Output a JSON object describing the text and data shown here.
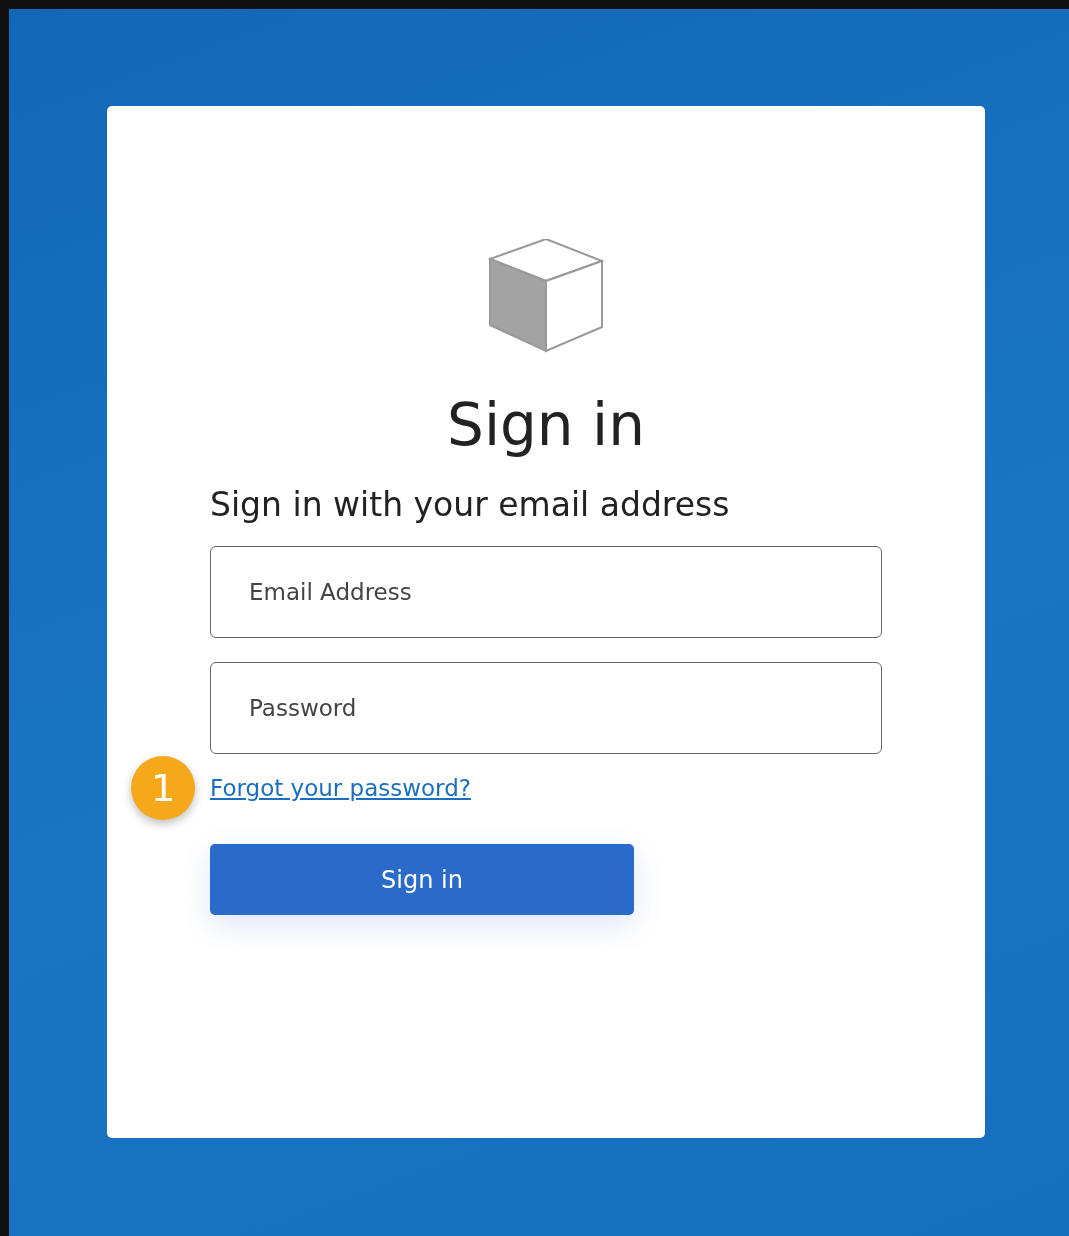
{
  "card": {
    "title": "Sign in",
    "subtitle": "Sign in with your email address",
    "fields": [
      {
        "placeholder": "Email Address"
      },
      {
        "placeholder": "Password"
      }
    ],
    "forgot_link": "Forgot your password?",
    "callout": "1",
    "button": "Sign in"
  }
}
